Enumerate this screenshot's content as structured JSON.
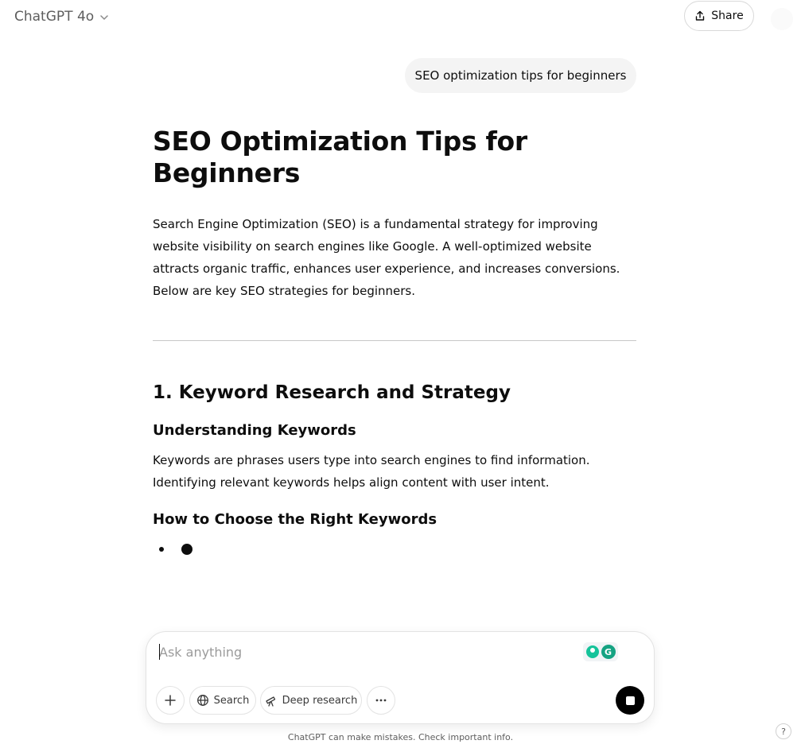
{
  "header": {
    "model_label": "ChatGPT 4o",
    "share_label": "Share"
  },
  "conversation": {
    "user_message": "SEO optimization tips for beginners",
    "response": {
      "title": "SEO Optimization Tips for Beginners",
      "intro": "Search Engine Optimization (SEO) is a fundamental strategy for improving website visibility on search engines like Google. A well-optimized website attracts organic traffic, enhances user experience, and increases conversions. Below are key SEO strategies for beginners.",
      "section1_heading": "1. Keyword Research and Strategy",
      "subheading1": "Understanding Keywords",
      "paragraph1": "Keywords are phrases users type into search engines to find information. Identifying relevant keywords helps align content with user intent.",
      "subheading2": "How to Choose the Right Keywords"
    }
  },
  "composer": {
    "placeholder": "Ask anything",
    "search_label": "Search",
    "deep_research_label": "Deep research",
    "grammarly_letter": "G"
  },
  "footer": {
    "disclaimer": "ChatGPT can make mistakes. Check important info.",
    "help_label": "?"
  },
  "colors": {
    "accent_black": "#000000",
    "grammarly_green": "#15c39a",
    "bubble_bg": "#f4f4f4"
  },
  "icons": [
    "chevron-down-icon",
    "share-icon",
    "plus-icon",
    "globe-icon",
    "telescope-icon",
    "ellipsis-icon",
    "stop-icon",
    "grammarly-icon"
  ]
}
